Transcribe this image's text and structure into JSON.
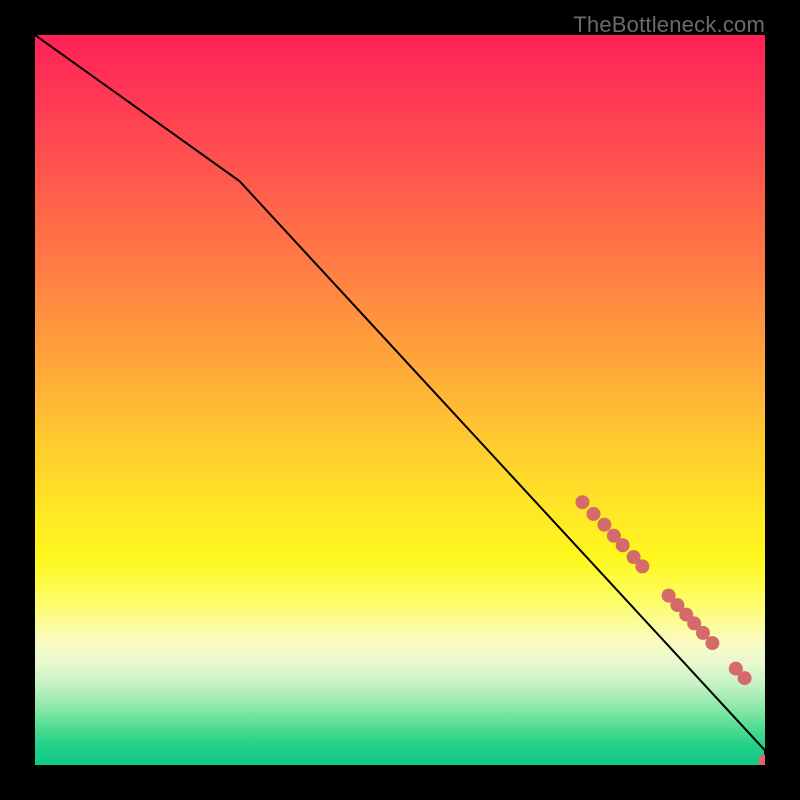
{
  "watermark": "TheBottleneck.com",
  "chart_data": {
    "type": "line",
    "title": "",
    "xlabel": "",
    "ylabel": "",
    "xlim": [
      0,
      100
    ],
    "ylim": [
      0,
      100
    ],
    "grid": false,
    "legend": false,
    "series": [
      {
        "name": "curve",
        "x": [
          0,
          28,
          100,
          100
        ],
        "y": [
          100,
          80,
          2,
          0
        ],
        "stroke": "#000000",
        "stroke_width": 2
      }
    ],
    "markers": {
      "name": "points",
      "color": "#d46a6a",
      "radius": 7,
      "points": [
        {
          "x": 75.0,
          "y": 36.0
        },
        {
          "x": 76.5,
          "y": 34.4
        },
        {
          "x": 78.0,
          "y": 32.9
        },
        {
          "x": 79.3,
          "y": 31.4
        },
        {
          "x": 80.5,
          "y": 30.1
        },
        {
          "x": 82.0,
          "y": 28.5
        },
        {
          "x": 83.2,
          "y": 27.2
        },
        {
          "x": 86.8,
          "y": 23.2
        },
        {
          "x": 88.0,
          "y": 21.9
        },
        {
          "x": 89.2,
          "y": 20.6
        },
        {
          "x": 90.3,
          "y": 19.4
        },
        {
          "x": 91.5,
          "y": 18.1
        },
        {
          "x": 92.8,
          "y": 16.7
        },
        {
          "x": 96.0,
          "y": 13.2
        },
        {
          "x": 97.2,
          "y": 11.9
        },
        {
          "x": 100.0,
          "y": 0.5
        },
        {
          "x": 101.0,
          "y": 0.5
        }
      ]
    },
    "background_gradient": {
      "type": "vertical",
      "stops": [
        {
          "pos": 0.0,
          "color": "#ff2156"
        },
        {
          "pos": 0.5,
          "color": "#ffc830"
        },
        {
          "pos": 0.72,
          "color": "#fff81f"
        },
        {
          "pos": 0.88,
          "color": "#d9f6cc"
        },
        {
          "pos": 1.0,
          "color": "#10c985"
        }
      ]
    }
  }
}
